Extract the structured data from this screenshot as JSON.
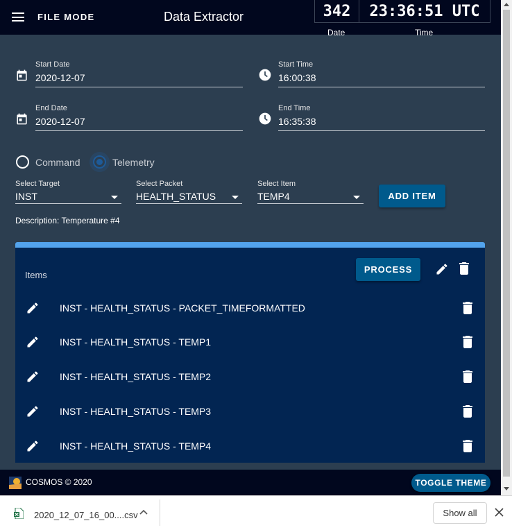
{
  "header": {
    "menu_icon": "hamburger-menu-icon",
    "file_mode": "FILE  MODE",
    "title": "Data Extractor",
    "clock": {
      "day": "342",
      "time": "23:36:51 UTC",
      "day_label": "Date",
      "time_label": "Time"
    }
  },
  "form": {
    "start_date": {
      "label": "Start Date",
      "value": "2020-12-07",
      "icon": "calendar-icon"
    },
    "start_time": {
      "label": "Start Time",
      "value": "16:00:38",
      "icon": "clock-icon"
    },
    "end_date": {
      "label": "End Date",
      "value": "2020-12-07",
      "icon": "calendar-icon"
    },
    "end_time": {
      "label": "End Time",
      "value": "16:35:38",
      "icon": "clock-icon"
    },
    "mode_options": [
      {
        "label": "Command",
        "selected": false
      },
      {
        "label": "Telemetry",
        "selected": true
      }
    ],
    "target": {
      "label": "Select Target",
      "value": "INST"
    },
    "packet": {
      "label": "Select Packet",
      "value": "HEALTH_STATUS"
    },
    "item": {
      "label": "Select Item",
      "value": "TEMP4"
    },
    "add_item": "ADD ITEM",
    "description": "Description: Temperature #4"
  },
  "items": {
    "title": "Items",
    "process": "PROCESS",
    "rows": [
      "INST - HEALTH_STATUS - PACKET_TIMEFORMATTED",
      "INST - HEALTH_STATUS - TEMP1",
      "INST - HEALTH_STATUS - TEMP2",
      "INST - HEALTH_STATUS - TEMP3",
      "INST - HEALTH_STATUS - TEMP4"
    ]
  },
  "footer": {
    "copyright": "COSMOS © 2020",
    "toggle_theme": "TOGGLE THEME"
  },
  "download_bar": {
    "file_name": "2020_12_07_16_00....csv",
    "show_all": "Show all"
  },
  "colors": {
    "background": "#2c3e50",
    "topbar": "#01071e",
    "button": "#005a8c",
    "card": "#022552",
    "card_accent": "#53a3ec"
  }
}
